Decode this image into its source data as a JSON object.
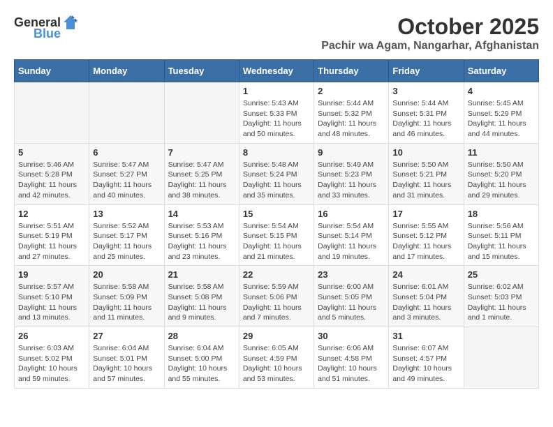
{
  "logo": {
    "text1": "General",
    "text2": "Blue"
  },
  "title": "October 2025",
  "location": "Pachir wa Agam, Nangarhar, Afghanistan",
  "weekdays": [
    "Sunday",
    "Monday",
    "Tuesday",
    "Wednesday",
    "Thursday",
    "Friday",
    "Saturday"
  ],
  "weeks": [
    [
      {
        "day": "",
        "info": ""
      },
      {
        "day": "",
        "info": ""
      },
      {
        "day": "",
        "info": ""
      },
      {
        "day": "1",
        "info": "Sunrise: 5:43 AM\nSunset: 5:33 PM\nDaylight: 11 hours\nand 50 minutes."
      },
      {
        "day": "2",
        "info": "Sunrise: 5:44 AM\nSunset: 5:32 PM\nDaylight: 11 hours\nand 48 minutes."
      },
      {
        "day": "3",
        "info": "Sunrise: 5:44 AM\nSunset: 5:31 PM\nDaylight: 11 hours\nand 46 minutes."
      },
      {
        "day": "4",
        "info": "Sunrise: 5:45 AM\nSunset: 5:29 PM\nDaylight: 11 hours\nand 44 minutes."
      }
    ],
    [
      {
        "day": "5",
        "info": "Sunrise: 5:46 AM\nSunset: 5:28 PM\nDaylight: 11 hours\nand 42 minutes."
      },
      {
        "day": "6",
        "info": "Sunrise: 5:47 AM\nSunset: 5:27 PM\nDaylight: 11 hours\nand 40 minutes."
      },
      {
        "day": "7",
        "info": "Sunrise: 5:47 AM\nSunset: 5:25 PM\nDaylight: 11 hours\nand 38 minutes."
      },
      {
        "day": "8",
        "info": "Sunrise: 5:48 AM\nSunset: 5:24 PM\nDaylight: 11 hours\nand 35 minutes."
      },
      {
        "day": "9",
        "info": "Sunrise: 5:49 AM\nSunset: 5:23 PM\nDaylight: 11 hours\nand 33 minutes."
      },
      {
        "day": "10",
        "info": "Sunrise: 5:50 AM\nSunset: 5:21 PM\nDaylight: 11 hours\nand 31 minutes."
      },
      {
        "day": "11",
        "info": "Sunrise: 5:50 AM\nSunset: 5:20 PM\nDaylight: 11 hours\nand 29 minutes."
      }
    ],
    [
      {
        "day": "12",
        "info": "Sunrise: 5:51 AM\nSunset: 5:19 PM\nDaylight: 11 hours\nand 27 minutes."
      },
      {
        "day": "13",
        "info": "Sunrise: 5:52 AM\nSunset: 5:17 PM\nDaylight: 11 hours\nand 25 minutes."
      },
      {
        "day": "14",
        "info": "Sunrise: 5:53 AM\nSunset: 5:16 PM\nDaylight: 11 hours\nand 23 minutes."
      },
      {
        "day": "15",
        "info": "Sunrise: 5:54 AM\nSunset: 5:15 PM\nDaylight: 11 hours\nand 21 minutes."
      },
      {
        "day": "16",
        "info": "Sunrise: 5:54 AM\nSunset: 5:14 PM\nDaylight: 11 hours\nand 19 minutes."
      },
      {
        "day": "17",
        "info": "Sunrise: 5:55 AM\nSunset: 5:12 PM\nDaylight: 11 hours\nand 17 minutes."
      },
      {
        "day": "18",
        "info": "Sunrise: 5:56 AM\nSunset: 5:11 PM\nDaylight: 11 hours\nand 15 minutes."
      }
    ],
    [
      {
        "day": "19",
        "info": "Sunrise: 5:57 AM\nSunset: 5:10 PM\nDaylight: 11 hours\nand 13 minutes."
      },
      {
        "day": "20",
        "info": "Sunrise: 5:58 AM\nSunset: 5:09 PM\nDaylight: 11 hours\nand 11 minutes."
      },
      {
        "day": "21",
        "info": "Sunrise: 5:58 AM\nSunset: 5:08 PM\nDaylight: 11 hours\nand 9 minutes."
      },
      {
        "day": "22",
        "info": "Sunrise: 5:59 AM\nSunset: 5:06 PM\nDaylight: 11 hours\nand 7 minutes."
      },
      {
        "day": "23",
        "info": "Sunrise: 6:00 AM\nSunset: 5:05 PM\nDaylight: 11 hours\nand 5 minutes."
      },
      {
        "day": "24",
        "info": "Sunrise: 6:01 AM\nSunset: 5:04 PM\nDaylight: 11 hours\nand 3 minutes."
      },
      {
        "day": "25",
        "info": "Sunrise: 6:02 AM\nSunset: 5:03 PM\nDaylight: 11 hours\nand 1 minute."
      }
    ],
    [
      {
        "day": "26",
        "info": "Sunrise: 6:03 AM\nSunset: 5:02 PM\nDaylight: 10 hours\nand 59 minutes."
      },
      {
        "day": "27",
        "info": "Sunrise: 6:04 AM\nSunset: 5:01 PM\nDaylight: 10 hours\nand 57 minutes."
      },
      {
        "day": "28",
        "info": "Sunrise: 6:04 AM\nSunset: 5:00 PM\nDaylight: 10 hours\nand 55 minutes."
      },
      {
        "day": "29",
        "info": "Sunrise: 6:05 AM\nSunset: 4:59 PM\nDaylight: 10 hours\nand 53 minutes."
      },
      {
        "day": "30",
        "info": "Sunrise: 6:06 AM\nSunset: 4:58 PM\nDaylight: 10 hours\nand 51 minutes."
      },
      {
        "day": "31",
        "info": "Sunrise: 6:07 AM\nSunset: 4:57 PM\nDaylight: 10 hours\nand 49 minutes."
      },
      {
        "day": "",
        "info": ""
      }
    ]
  ]
}
